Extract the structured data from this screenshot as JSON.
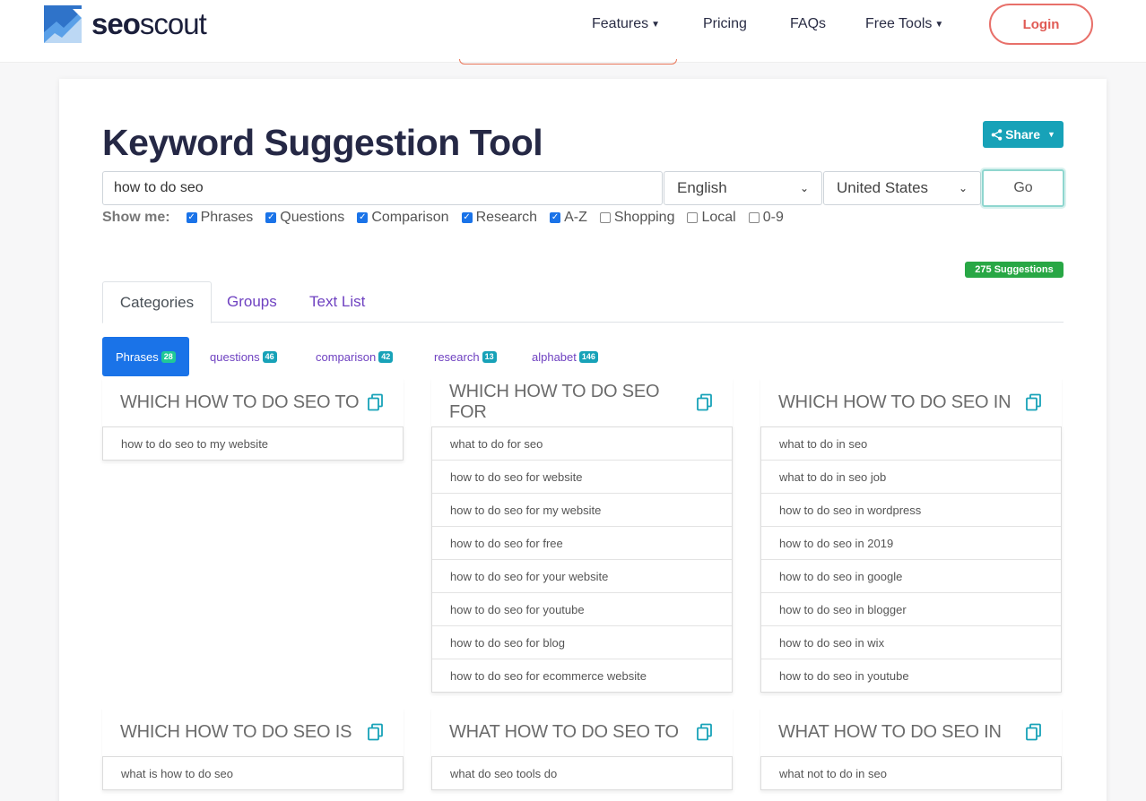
{
  "header": {
    "brand_bold": "seo",
    "brand_light": "scout",
    "nav": [
      {
        "label": "Features",
        "dropdown": true
      },
      {
        "label": "Pricing",
        "dropdown": false
      },
      {
        "label": "FAQs",
        "dropdown": false
      },
      {
        "label": "Free Tools",
        "dropdown": true
      }
    ],
    "login_label": "Login"
  },
  "tool": {
    "title": "Keyword Suggestion Tool",
    "share_label": "Share",
    "keyword_value": "how to do seo",
    "language": "English",
    "country": "United States",
    "go_label": "Go",
    "show_me_label": "Show me:",
    "filters": [
      {
        "label": "Phrases",
        "checked": true
      },
      {
        "label": "Questions",
        "checked": true
      },
      {
        "label": "Comparison",
        "checked": true
      },
      {
        "label": "Research",
        "checked": true
      },
      {
        "label": "A-Z",
        "checked": true
      },
      {
        "label": "Shopping",
        "checked": false
      },
      {
        "label": "Local",
        "checked": false
      },
      {
        "label": "0-9",
        "checked": false
      }
    ],
    "suggestions_badge": "275 Suggestions"
  },
  "tabs": [
    {
      "label": "Categories",
      "active": true
    },
    {
      "label": "Groups",
      "active": false
    },
    {
      "label": "Text List",
      "active": false
    }
  ],
  "categories": [
    {
      "label": "Phrases",
      "count": "28",
      "active": true
    },
    {
      "label": "questions",
      "count": "46",
      "active": false
    },
    {
      "label": "comparison",
      "count": "42",
      "active": false
    },
    {
      "label": "research",
      "count": "13",
      "active": false
    },
    {
      "label": "alphabet",
      "count": "146",
      "active": false
    }
  ],
  "groups": [
    {
      "title": "WHICH HOW TO DO SEO TO",
      "items": [
        "how to do seo to my website"
      ]
    },
    {
      "title": "WHICH HOW TO DO SEO FOR",
      "items": [
        "what to do for seo",
        "how to do seo for website",
        "how to do seo for my website",
        "how to do seo for free",
        "how to do seo for your website",
        "how to do seo for youtube",
        "how to do seo for blog",
        "how to do seo for ecommerce website"
      ]
    },
    {
      "title": "WHICH HOW TO DO SEO IN",
      "items": [
        "what to do in seo",
        "what to do in seo job",
        "how to do seo in wordpress",
        "how to do seo in 2019",
        "how to do seo in google",
        "how to do seo in blogger",
        "how to do seo in wix",
        "how to do seo in youtube"
      ]
    },
    {
      "title": "WHICH HOW TO DO SEO IS",
      "items": [
        "what is how to do seo"
      ]
    },
    {
      "title": "WHAT HOW TO DO SEO TO",
      "items": [
        "what do seo tools do"
      ]
    },
    {
      "title": "WHAT HOW TO DO SEO IN",
      "items": [
        "what not to do in seo"
      ]
    }
  ],
  "colors": {
    "accent_blue": "#1a73e8",
    "teal": "#17a2b8",
    "login_red": "#e05a54",
    "success_green": "#28a745",
    "link_purple": "#6f42c1"
  }
}
